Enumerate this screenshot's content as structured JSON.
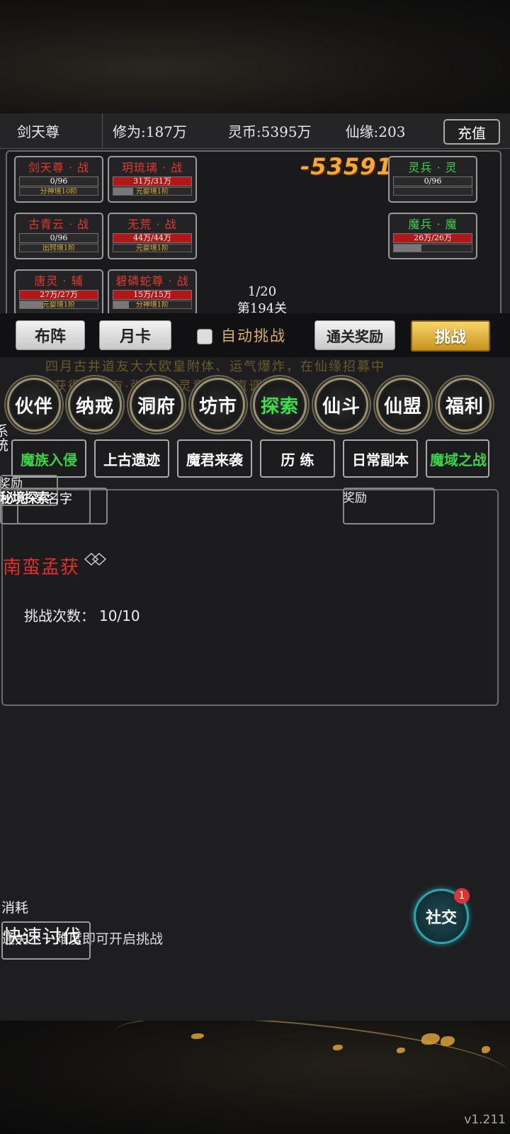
{
  "header": {
    "player_name": "剑天尊",
    "cultivation": "修为:187万",
    "spirit_coins": "灵币:5395万",
    "fate": "仙缘:203",
    "recharge_label": "充值"
  },
  "battle": {
    "damage_number": "-53591",
    "wave": "1/20",
    "stage": "第194关",
    "allies": [
      {
        "name": "剑天尊 · 战",
        "hp": "0/96",
        "realm": "分神境10阶",
        "hp_fraction": 0
      },
      {
        "name": "玥琉璃 · 战",
        "hp": "31万/31万",
        "realm": "元婴境1阶",
        "hp_fraction": 1
      },
      {
        "name": "古青云 · 战",
        "hp": "0/96",
        "realm": "出窍境1阶",
        "hp_fraction": 0
      },
      {
        "name": "无荒 · 战",
        "hp": "44万/44万",
        "realm": "元婴境1阶",
        "hp_fraction": 1
      },
      {
        "name": "唐灵 · 辅",
        "hp": "27万/27万",
        "realm": "元婴境1阶",
        "hp_fraction": 1
      },
      {
        "name": "碧磷蛇尊 · 战",
        "hp": "15万/15万",
        "realm": "分神境1阶",
        "hp_fraction": 1
      }
    ],
    "enemies": [
      {
        "name": "灵兵 · 灵",
        "hp": "0/96",
        "hp_fraction": 0
      },
      {
        "name": "魔兵 · 魔",
        "hp": "26万/26万",
        "hp_fraction": 1
      }
    ]
  },
  "actions": {
    "formation": "布阵",
    "month_card": "月卡",
    "auto_challenge": "自动挑战",
    "clear_reward": "通关奖励",
    "challenge": "挑战"
  },
  "marquee": {
    "line1": "四月古井道友大大欧皇附体、运气爆炸，在仙缘招募中",
    "line2": "获得了稀有·张天·天灵意，简直调傣了！"
  },
  "round_menu": [
    "伙伴",
    "纳戒",
    "洞府",
    "坊市",
    "探索",
    "仙斗",
    "仙盟",
    "福利"
  ],
  "tabs": [
    "魔族入侵",
    "上古遗迹",
    "魔君来袭",
    "历 练",
    "日常副本",
    "魔域之战"
  ],
  "panel": {
    "reward_label_left": "奖励",
    "overlap_text": "秘境探索",
    "overlap_text2": "名字",
    "reward_label_right": "奖励",
    "boss_name": "南蛮孟获",
    "attempts_label": "挑战次数：",
    "attempts_value": "10/10"
  },
  "bottom": {
    "cost_label": "消耗",
    "fast_battle": "快速讨伐",
    "hint": "通关上一难度即可开启挑战",
    "social": "社交",
    "social_badge": "1",
    "version": "v1.211"
  },
  "side_text": "系统"
}
